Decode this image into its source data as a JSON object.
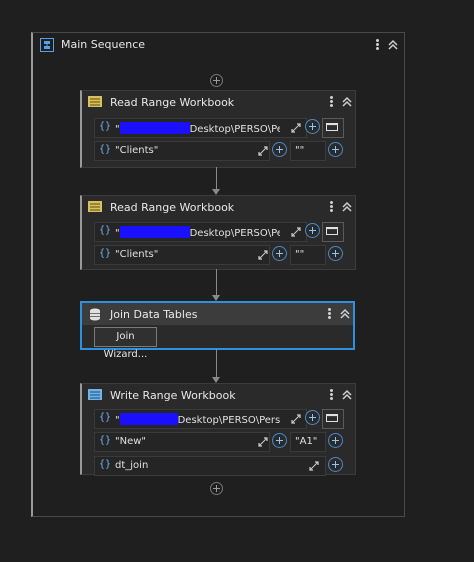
{
  "sequence": {
    "title": "Main Sequence"
  },
  "activities": [
    {
      "title": "Read Range Workbook",
      "path_prefix": "\"",
      "path_suffix": "Desktop\\PERSO\\Persc",
      "sheet": "\"Clients\"",
      "range": "\"\""
    },
    {
      "title": "Read Range Workbook",
      "path_prefix": "\"",
      "path_suffix": "Desktop\\PERSO\\Persc",
      "sheet": "\"Clients\"",
      "range": "\"\""
    },
    {
      "title": "Join Data Tables",
      "wizard_label": "Join Wizard..."
    },
    {
      "title": "Write Range Workbook",
      "path_prefix": "\"",
      "path_suffix": "Desktop\\PERSO\\Persc",
      "sheet": "\"New\"",
      "range": "\"A1\"",
      "datatable": "dt_join"
    }
  ],
  "icons": {
    "sequence": "sequence-icon",
    "read": "excel-read-icon",
    "join": "database-icon",
    "write": "excel-write-icon",
    "brace": "expression-braces-icon",
    "expand": "expand-icon",
    "plus": "plus-circle-icon",
    "folder": "folder-icon",
    "more": "more-vertical-icon",
    "collapse": "chevron-double-up-icon"
  },
  "colors": {
    "accent": "#2f8fe0",
    "redaction": "#1a0fff",
    "brace": "#6fb0f0"
  }
}
